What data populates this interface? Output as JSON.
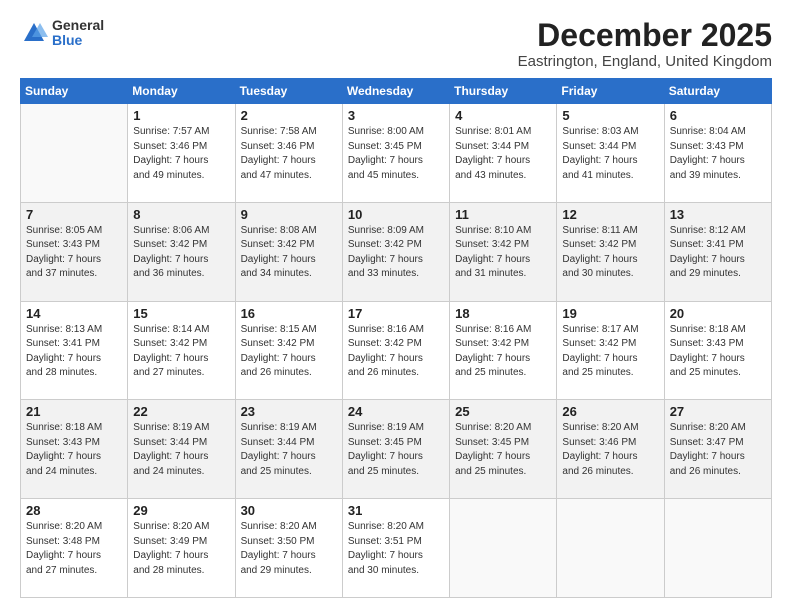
{
  "logo": {
    "general": "General",
    "blue": "Blue"
  },
  "title": "December 2025",
  "location": "Eastrington, England, United Kingdom",
  "days_header": [
    "Sunday",
    "Monday",
    "Tuesday",
    "Wednesday",
    "Thursday",
    "Friday",
    "Saturday"
  ],
  "weeks": [
    [
      {
        "day": "",
        "info": ""
      },
      {
        "day": "1",
        "info": "Sunrise: 7:57 AM\nSunset: 3:46 PM\nDaylight: 7 hours\nand 49 minutes."
      },
      {
        "day": "2",
        "info": "Sunrise: 7:58 AM\nSunset: 3:46 PM\nDaylight: 7 hours\nand 47 minutes."
      },
      {
        "day": "3",
        "info": "Sunrise: 8:00 AM\nSunset: 3:45 PM\nDaylight: 7 hours\nand 45 minutes."
      },
      {
        "day": "4",
        "info": "Sunrise: 8:01 AM\nSunset: 3:44 PM\nDaylight: 7 hours\nand 43 minutes."
      },
      {
        "day": "5",
        "info": "Sunrise: 8:03 AM\nSunset: 3:44 PM\nDaylight: 7 hours\nand 41 minutes."
      },
      {
        "day": "6",
        "info": "Sunrise: 8:04 AM\nSunset: 3:43 PM\nDaylight: 7 hours\nand 39 minutes."
      }
    ],
    [
      {
        "day": "7",
        "info": "Sunrise: 8:05 AM\nSunset: 3:43 PM\nDaylight: 7 hours\nand 37 minutes."
      },
      {
        "day": "8",
        "info": "Sunrise: 8:06 AM\nSunset: 3:42 PM\nDaylight: 7 hours\nand 36 minutes."
      },
      {
        "day": "9",
        "info": "Sunrise: 8:08 AM\nSunset: 3:42 PM\nDaylight: 7 hours\nand 34 minutes."
      },
      {
        "day": "10",
        "info": "Sunrise: 8:09 AM\nSunset: 3:42 PM\nDaylight: 7 hours\nand 33 minutes."
      },
      {
        "day": "11",
        "info": "Sunrise: 8:10 AM\nSunset: 3:42 PM\nDaylight: 7 hours\nand 31 minutes."
      },
      {
        "day": "12",
        "info": "Sunrise: 8:11 AM\nSunset: 3:42 PM\nDaylight: 7 hours\nand 30 minutes."
      },
      {
        "day": "13",
        "info": "Sunrise: 8:12 AM\nSunset: 3:41 PM\nDaylight: 7 hours\nand 29 minutes."
      }
    ],
    [
      {
        "day": "14",
        "info": "Sunrise: 8:13 AM\nSunset: 3:41 PM\nDaylight: 7 hours\nand 28 minutes."
      },
      {
        "day": "15",
        "info": "Sunrise: 8:14 AM\nSunset: 3:42 PM\nDaylight: 7 hours\nand 27 minutes."
      },
      {
        "day": "16",
        "info": "Sunrise: 8:15 AM\nSunset: 3:42 PM\nDaylight: 7 hours\nand 26 minutes."
      },
      {
        "day": "17",
        "info": "Sunrise: 8:16 AM\nSunset: 3:42 PM\nDaylight: 7 hours\nand 26 minutes."
      },
      {
        "day": "18",
        "info": "Sunrise: 8:16 AM\nSunset: 3:42 PM\nDaylight: 7 hours\nand 25 minutes."
      },
      {
        "day": "19",
        "info": "Sunrise: 8:17 AM\nSunset: 3:42 PM\nDaylight: 7 hours\nand 25 minutes."
      },
      {
        "day": "20",
        "info": "Sunrise: 8:18 AM\nSunset: 3:43 PM\nDaylight: 7 hours\nand 25 minutes."
      }
    ],
    [
      {
        "day": "21",
        "info": "Sunrise: 8:18 AM\nSunset: 3:43 PM\nDaylight: 7 hours\nand 24 minutes."
      },
      {
        "day": "22",
        "info": "Sunrise: 8:19 AM\nSunset: 3:44 PM\nDaylight: 7 hours\nand 24 minutes."
      },
      {
        "day": "23",
        "info": "Sunrise: 8:19 AM\nSunset: 3:44 PM\nDaylight: 7 hours\nand 25 minutes."
      },
      {
        "day": "24",
        "info": "Sunrise: 8:19 AM\nSunset: 3:45 PM\nDaylight: 7 hours\nand 25 minutes."
      },
      {
        "day": "25",
        "info": "Sunrise: 8:20 AM\nSunset: 3:45 PM\nDaylight: 7 hours\nand 25 minutes."
      },
      {
        "day": "26",
        "info": "Sunrise: 8:20 AM\nSunset: 3:46 PM\nDaylight: 7 hours\nand 26 minutes."
      },
      {
        "day": "27",
        "info": "Sunrise: 8:20 AM\nSunset: 3:47 PM\nDaylight: 7 hours\nand 26 minutes."
      }
    ],
    [
      {
        "day": "28",
        "info": "Sunrise: 8:20 AM\nSunset: 3:48 PM\nDaylight: 7 hours\nand 27 minutes."
      },
      {
        "day": "29",
        "info": "Sunrise: 8:20 AM\nSunset: 3:49 PM\nDaylight: 7 hours\nand 28 minutes."
      },
      {
        "day": "30",
        "info": "Sunrise: 8:20 AM\nSunset: 3:50 PM\nDaylight: 7 hours\nand 29 minutes."
      },
      {
        "day": "31",
        "info": "Sunrise: 8:20 AM\nSunset: 3:51 PM\nDaylight: 7 hours\nand 30 minutes."
      },
      {
        "day": "",
        "info": ""
      },
      {
        "day": "",
        "info": ""
      },
      {
        "day": "",
        "info": ""
      }
    ]
  ]
}
